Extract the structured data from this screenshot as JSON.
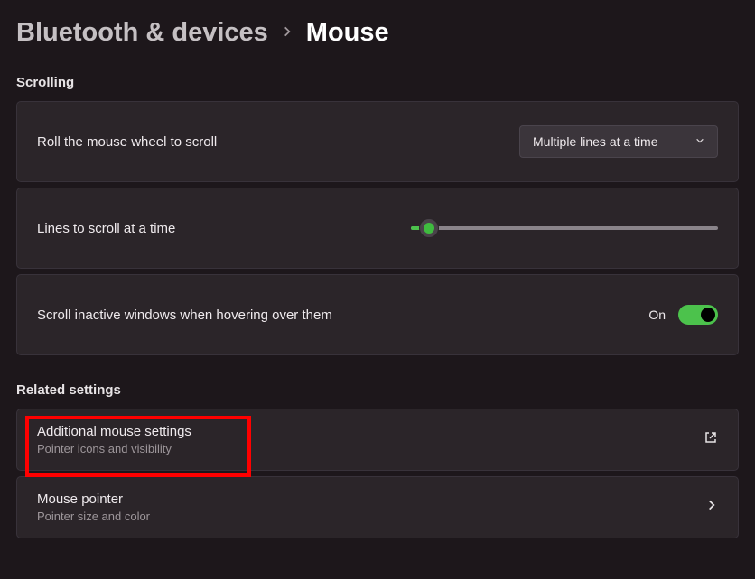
{
  "breadcrumb": {
    "parent": "Bluetooth & devices",
    "current": "Mouse"
  },
  "sections": {
    "scrolling": {
      "title": "Scrolling",
      "roll_label": "Roll the mouse wheel to scroll",
      "roll_value": "Multiple lines at a time",
      "lines_label": "Lines to scroll at a time",
      "lines_value": 3,
      "inactive_label": "Scroll inactive windows when hovering over them",
      "inactive_state": "On",
      "inactive_on": true
    },
    "related": {
      "title": "Related settings",
      "items": [
        {
          "label": "Additional mouse settings",
          "sublabel": "Pointer icons and visibility",
          "icon": "external-link",
          "highlighted": true
        },
        {
          "label": "Mouse pointer",
          "sublabel": "Pointer size and color",
          "icon": "chevron-right",
          "highlighted": false
        }
      ]
    }
  }
}
